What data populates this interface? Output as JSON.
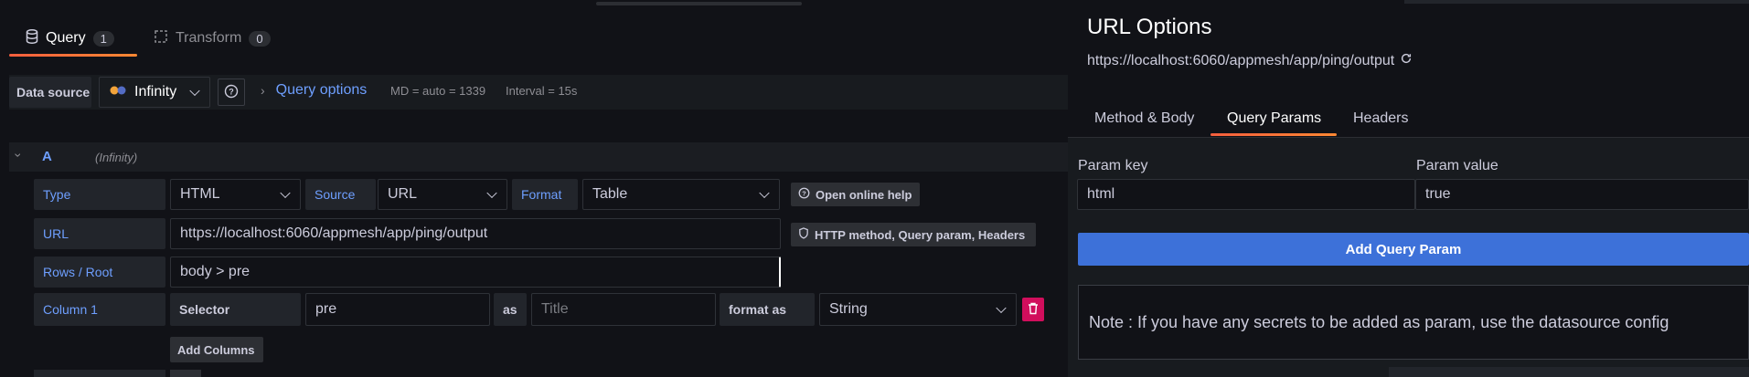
{
  "tabs": {
    "query": {
      "label": "Query",
      "count": "1"
    },
    "transform": {
      "label": "Transform",
      "count": "0"
    }
  },
  "datasource_bar": {
    "label": "Data source",
    "selected": "Infinity",
    "query_options_label": "Query options",
    "md": "MD = auto = 1339",
    "interval": "Interval = 15s"
  },
  "query_row": {
    "ref_id": "A",
    "datasource_note": "(Infinity)"
  },
  "fields": {
    "type_label": "Type",
    "type_value": "HTML",
    "source_label": "Source",
    "source_value": "URL",
    "format_label": "Format",
    "format_value": "Table",
    "help_button": "Open online help",
    "url_label": "URL",
    "url_value": "https://localhost:6060/appmesh/app/ping/output",
    "http_button": "HTTP method, Query param, Headers",
    "rows_label": "Rows / Root",
    "rows_value": "body > pre",
    "column_label": "Column 1",
    "selector_label": "Selector",
    "selector_value": "pre",
    "as_label": "as",
    "title_placeholder": "Title",
    "format_as_label": "format as",
    "format_as_value": "String",
    "add_columns": "Add Columns"
  },
  "url_options": {
    "title": "URL Options",
    "url": "https://localhost:6060/appmesh/app/ping/output",
    "tabs": [
      "Method & Body",
      "Query Params",
      "Headers"
    ],
    "active_tab": "Query Params",
    "param_key_label": "Param key",
    "param_value_label": "Param value",
    "param_key": "html",
    "param_value": "true",
    "add_button": "Add Query Param",
    "note": "Note : If you have any secrets to be added as param, use the datasource config"
  },
  "colors": {
    "accent_orange": "#f55f3e",
    "link_blue": "#6e9fff",
    "primary_button": "#3d71d9",
    "danger": "#d10e5c"
  }
}
